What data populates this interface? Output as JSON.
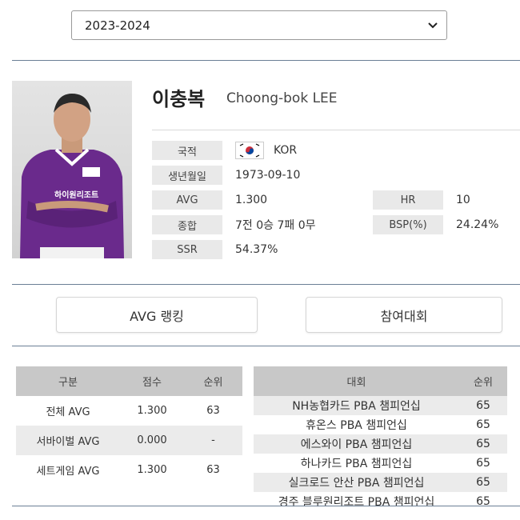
{
  "season": {
    "selected": "2023-2024"
  },
  "player": {
    "name_ko": "이충복",
    "name_en": "Choong-bok LEE",
    "photo_text": "하이원리조트"
  },
  "profile": {
    "nation_label": "국적",
    "nation_value": "KOR",
    "birth_label": "생년월일",
    "birth_value": "1973-09-10",
    "avg_label": "AVG",
    "avg_value": "1.300",
    "hr_label": "HR",
    "hr_value": "10",
    "record_label": "종합",
    "record_value": "7전 0승 7패 0무",
    "bsp_label": "BSP(%)",
    "bsp_value": "24.24%",
    "ssr_label": "SSR",
    "ssr_value": "54.37%"
  },
  "tabs": {
    "avg_ranking": "AVG 랭킹",
    "tournaments": "참여대회"
  },
  "rank_table": {
    "headers": [
      "구분",
      "점수",
      "순위"
    ],
    "rows": [
      [
        "전체 AVG",
        "1.300",
        "63"
      ],
      [
        "서바이벌 AVG",
        "0.000",
        "-"
      ],
      [
        "세트게임 AVG",
        "1.300",
        "63"
      ]
    ]
  },
  "tournament_table": {
    "headers": [
      "대회",
      "순위"
    ],
    "rows": [
      [
        "NH농협카드 PBA 챔피언십",
        "65"
      ],
      [
        "휴온스 PBA 챔피언십",
        "65"
      ],
      [
        "에스와이 PBA 챔피언십",
        "65"
      ],
      [
        "하나카드 PBA 챔피언십",
        "65"
      ],
      [
        "실크로드 안산 PBA 챔피언십",
        "65"
      ],
      [
        "경주 블루원리조트 PBA 챔피언십",
        "65"
      ]
    ]
  },
  "colors": {
    "header_bg": "#c8c8c8",
    "shade_bg": "#ebebeb",
    "divider": "#6b7f95",
    "jersey": "#6a2a8c"
  }
}
